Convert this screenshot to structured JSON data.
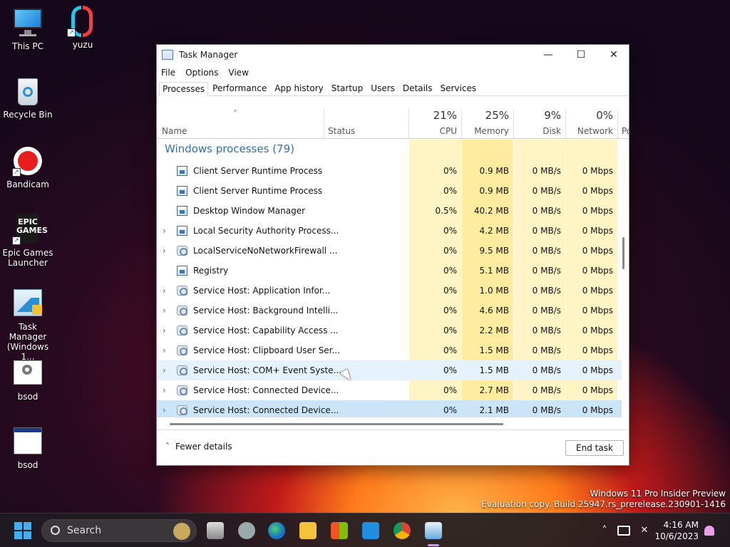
{
  "desktop": {
    "icons": [
      {
        "label": "This PC",
        "icon": "monitor-icon"
      },
      {
        "label": "yuzu",
        "icon": "yuzu-icon"
      },
      {
        "label": "Recycle Bin",
        "icon": "recycle-bin-icon"
      },
      {
        "label": "Bandicam",
        "icon": "record-icon"
      },
      {
        "label": "Epic Games Launcher",
        "icon": "epic-games-icon",
        "logo_text": "EPIC GAMES"
      },
      {
        "label": "Task Manager (Windows 1...",
        "icon": "task-manager-icon"
      },
      {
        "label": "bsod",
        "icon": "settings-file-icon"
      },
      {
        "label": "bsod",
        "icon": "window-file-icon"
      }
    ],
    "watermark": {
      "line1": "Windows 11 Pro Insider Preview",
      "line2": "Evaluation copy. Build 25947.rs_prerelease.230901-1416"
    }
  },
  "window": {
    "title": "Task Manager",
    "controls": {
      "minimize": "—",
      "maximize": "☐",
      "close": "✕"
    },
    "menu": [
      "File",
      "Options",
      "View"
    ],
    "tabs": [
      "Processes",
      "Performance",
      "App history",
      "Startup",
      "Users",
      "Details",
      "Services"
    ],
    "active_tab": "Processes",
    "sort_arrow": "˄",
    "columns": {
      "name": "Name",
      "status": "Status",
      "cpu": {
        "pct": "21%",
        "label": "CPU"
      },
      "memory": {
        "pct": "25%",
        "label": "Memory"
      },
      "disk": {
        "pct": "9%",
        "label": "Disk"
      },
      "network": {
        "pct": "0%",
        "label": "Network"
      },
      "power": "Po"
    },
    "group": "Windows processes (79)",
    "processes": [
      {
        "name": "Client Server Runtime Process",
        "expandable": false,
        "icon": "box",
        "cpu": "0%",
        "memory": "0.9 MB",
        "disk": "0 MB/s",
        "network": "0 Mbps"
      },
      {
        "name": "Client Server Runtime Process",
        "expandable": false,
        "icon": "box",
        "cpu": "0%",
        "memory": "0.9 MB",
        "disk": "0 MB/s",
        "network": "0 Mbps"
      },
      {
        "name": "Desktop Window Manager",
        "expandable": false,
        "icon": "box",
        "cpu": "0.5%",
        "memory": "40.2 MB",
        "disk": "0 MB/s",
        "network": "0 Mbps"
      },
      {
        "name": "Local Security Authority Process...",
        "expandable": true,
        "icon": "box",
        "cpu": "0%",
        "memory": "4.2 MB",
        "disk": "0 MB/s",
        "network": "0 Mbps"
      },
      {
        "name": "LocalServiceNoNetworkFirewall ...",
        "expandable": true,
        "icon": "gear",
        "cpu": "0%",
        "memory": "9.5 MB",
        "disk": "0 MB/s",
        "network": "0 Mbps"
      },
      {
        "name": "Registry",
        "expandable": false,
        "icon": "box",
        "cpu": "0%",
        "memory": "5.1 MB",
        "disk": "0 MB/s",
        "network": "0 Mbps"
      },
      {
        "name": "Service Host: Application Infor...",
        "expandable": true,
        "icon": "gear",
        "cpu": "0%",
        "memory": "1.0 MB",
        "disk": "0 MB/s",
        "network": "0 Mbps"
      },
      {
        "name": "Service Host: Background Intelli...",
        "expandable": true,
        "icon": "gear",
        "cpu": "0%",
        "memory": "4.6 MB",
        "disk": "0 MB/s",
        "network": "0 Mbps"
      },
      {
        "name": "Service Host: Capability Access ...",
        "expandable": true,
        "icon": "gear",
        "cpu": "0%",
        "memory": "2.2 MB",
        "disk": "0 MB/s",
        "network": "0 Mbps"
      },
      {
        "name": "Service Host: Clipboard User Ser...",
        "expandable": true,
        "icon": "gear",
        "cpu": "0%",
        "memory": "1.5 MB",
        "disk": "0 MB/s",
        "network": "0 Mbps"
      },
      {
        "name": "Service Host: COM+ Event Syste...",
        "expandable": true,
        "icon": "gear",
        "cpu": "0%",
        "memory": "1.5 MB",
        "disk": "0 MB/s",
        "network": "0 Mbps",
        "state": "hover"
      },
      {
        "name": "Service Host: Connected Device...",
        "expandable": true,
        "icon": "gear",
        "cpu": "0%",
        "memory": "2.7 MB",
        "disk": "0 MB/s",
        "network": "0 Mbps"
      },
      {
        "name": "Service Host: Connected Device...",
        "expandable": true,
        "icon": "gear",
        "cpu": "0%",
        "memory": "2.1 MB",
        "disk": "0 MB/s",
        "network": "0 Mbps",
        "state": "selected"
      }
    ],
    "footer": {
      "fewer_details": "Fewer details",
      "end_task": "End task"
    }
  },
  "taskbar": {
    "search_label": "Search",
    "clock_time": "4:16 AM",
    "clock_date": "10/6/2023",
    "icons": [
      "start-icon",
      "search-icon",
      "task-view-icon",
      "weather-icon",
      "edge-icon",
      "file-explorer-icon",
      "store-icon",
      "mail-icon",
      "chrome-icon",
      "task-manager-icon",
      "chevron-up-icon",
      "network-icon",
      "volume-muted-icon",
      "notification-bell-icon"
    ]
  },
  "colors": {
    "heat_light": "#fff4c4",
    "heat_mid": "#ffec9e",
    "group_blue": "#2f6fb5",
    "selected": "#cce4f7",
    "hover": "#e5f1fb"
  }
}
